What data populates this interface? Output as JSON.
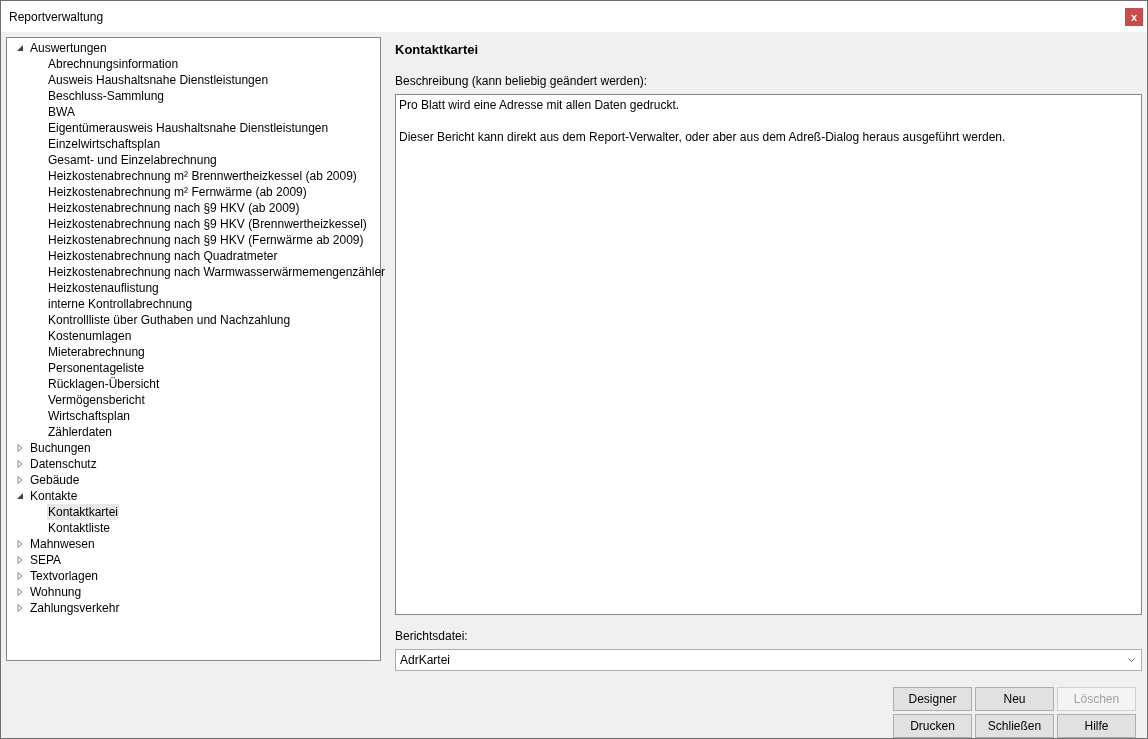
{
  "window": {
    "title": "Reportverwaltung",
    "close": "x"
  },
  "tree": [
    {
      "label": "Auswertungen",
      "expanded": true,
      "children": [
        {
          "label": "Abrechnungsinformation",
          "selected": false
        },
        {
          "label": "Ausweis Haushaltsnahe Dienstleistungen",
          "selected": false
        },
        {
          "label": "Beschluss-Sammlung",
          "selected": false
        },
        {
          "label": "BWA",
          "selected": false
        },
        {
          "label": "Eigentümerausweis Haushaltsnahe Dienstleistungen",
          "selected": false
        },
        {
          "label": "Einzelwirtschaftsplan",
          "selected": false
        },
        {
          "label": "Gesamt- und Einzelabrechnung",
          "selected": false
        },
        {
          "label": "Heizkostenabrechnung m² Brennwertheizkessel (ab 2009)",
          "selected": false
        },
        {
          "label": "Heizkostenabrechnung m² Fernwärme (ab 2009)",
          "selected": false
        },
        {
          "label": "Heizkostenabrechnung nach §9 HKV (ab 2009)",
          "selected": false
        },
        {
          "label": "Heizkostenabrechnung nach §9 HKV (Brennwertheizkessel)",
          "selected": false
        },
        {
          "label": "Heizkostenabrechnung nach §9 HKV (Fernwärme ab 2009)",
          "selected": false
        },
        {
          "label": "Heizkostenabrechnung nach Quadratmeter",
          "selected": false
        },
        {
          "label": "Heizkostenabrechnung nach Warmwasserwärmemengenzähler",
          "selected": false
        },
        {
          "label": "Heizkostenauflistung",
          "selected": false
        },
        {
          "label": "interne Kontrollabrechnung",
          "selected": false
        },
        {
          "label": "Kontrollliste über Guthaben und Nachzahlung",
          "selected": false
        },
        {
          "label": "Kostenumlagen",
          "selected": false
        },
        {
          "label": "Mieterabrechnung",
          "selected": false
        },
        {
          "label": "Personentageliste",
          "selected": false
        },
        {
          "label": "Rücklagen-Übersicht",
          "selected": false
        },
        {
          "label": "Vermögensbericht",
          "selected": false
        },
        {
          "label": "Wirtschaftsplan",
          "selected": false
        },
        {
          "label": "Zählerdaten",
          "selected": false
        }
      ]
    },
    {
      "label": "Buchungen",
      "expanded": false
    },
    {
      "label": "Datenschutz",
      "expanded": false
    },
    {
      "label": "Gebäude",
      "expanded": false
    },
    {
      "label": "Kontakte",
      "expanded": true,
      "children": [
        {
          "label": "Kontaktkartei",
          "selected": true
        },
        {
          "label": "Kontaktliste",
          "selected": false
        }
      ]
    },
    {
      "label": "Mahnwesen",
      "expanded": false
    },
    {
      "label": "SEPA",
      "expanded": false
    },
    {
      "label": "Textvorlagen",
      "expanded": false
    },
    {
      "label": "Wohnung",
      "expanded": false
    },
    {
      "label": "Zahlungsverkehr",
      "expanded": false
    }
  ],
  "detail": {
    "title": "Kontaktkartei",
    "description_label": "Beschreibung (kann beliebig geändert werden):",
    "description": [
      "Pro Blatt wird eine Adresse mit allen Daten gedruckt.",
      "Dieser Bericht kann direkt aus dem Report-Verwalter, oder aber aus dem Adreß-Dialog heraus ausgeführt werden."
    ],
    "file_label": "Berichtsdatei:",
    "file_value": "AdrKartei"
  },
  "buttons": [
    {
      "label": "Designer",
      "disabled": false
    },
    {
      "label": "Neu",
      "disabled": false
    },
    {
      "label": "Löschen",
      "disabled": true
    },
    {
      "label": "Drucken",
      "disabled": false
    },
    {
      "label": "Schließen",
      "disabled": false
    },
    {
      "label": "Hilfe",
      "disabled": false
    }
  ]
}
